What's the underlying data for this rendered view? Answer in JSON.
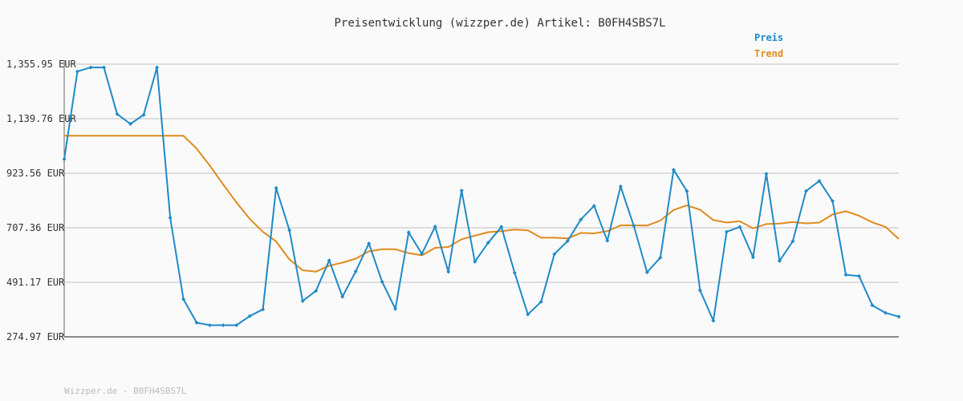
{
  "chart_data": {
    "type": "line",
    "title": "Preisentwicklung (wizzper.de) Artikel: B0FH4SBS7L",
    "footer": "Wizzper.de - B0FH4SBS7L",
    "ylim": [
      274.97,
      1355.95
    ],
    "yticks": [
      "1,355.95 EUR",
      "1,139.76 EUR",
      "923.56 EUR",
      "707.36 EUR",
      "491.17 EUR",
      "274.97 EUR"
    ],
    "ytick_values": [
      1355.95,
      1139.76,
      923.56,
      707.36,
      491.17,
      274.97
    ],
    "grid": true,
    "legend_position": "top-right",
    "series": [
      {
        "name": "Preis",
        "color": "#1f8ac8",
        "values": [
          979,
          1327,
          1343,
          1343,
          1158,
          1119,
          1155,
          1343,
          747,
          424,
          331,
          321,
          321,
          321,
          357,
          384,
          865,
          698,
          417,
          457,
          578,
          434,
          534,
          645,
          493,
          386,
          689,
          604,
          712,
          533,
          855,
          573,
          648,
          711,
          529,
          364,
          414,
          603,
          655,
          740,
          794,
          656,
          871,
          715,
          531,
          589,
          937,
          853,
          459,
          339,
          691,
          711,
          590,
          921,
          576,
          654,
          853,
          893,
          813,
          521,
          516,
          400,
          370,
          355
        ]
      },
      {
        "name": "Trend",
        "color": "#e08a1e",
        "values": [
          1072,
          1072,
          1072,
          1072,
          1072,
          1072,
          1072,
          1072,
          1072,
          1072,
          1021,
          953,
          879,
          808,
          743,
          691,
          653,
          582,
          539,
          533,
          557,
          569,
          585,
          614,
          622,
          622,
          607,
          598,
          628,
          631,
          662,
          676,
          690,
          694,
          700,
          697,
          668,
          668,
          665,
          687,
          685,
          694,
          717,
          717,
          716,
          736,
          778,
          796,
          779,
          738,
          728,
          733,
          705,
          722,
          724,
          730,
          725,
          728,
          760,
          773,
          755,
          729,
          711,
          663
        ]
      }
    ]
  }
}
